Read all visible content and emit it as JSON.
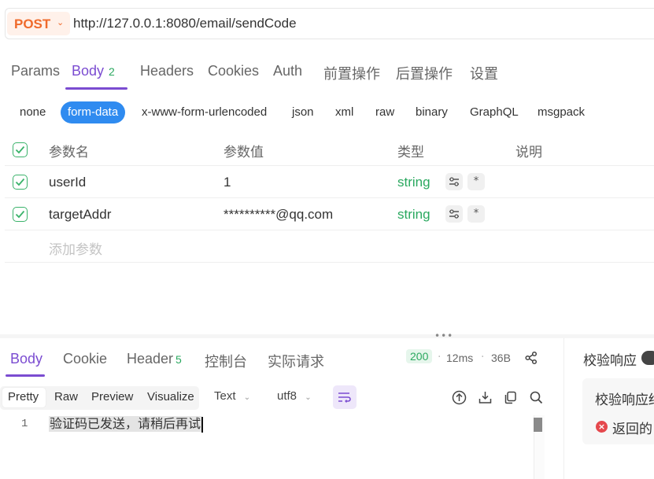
{
  "request": {
    "method": "POST",
    "url": "http://127.0.0.1:8080/email/sendCode"
  },
  "request_tabs": [
    {
      "label": "Params"
    },
    {
      "label": "Body",
      "badge": "2"
    },
    {
      "label": "Headers"
    },
    {
      "label": "Cookies"
    },
    {
      "label": "Auth"
    },
    {
      "label": "前置操作"
    },
    {
      "label": "后置操作"
    },
    {
      "label": "设置"
    }
  ],
  "body_types": [
    "none",
    "form-data",
    "x-www-form-urlencoded",
    "json",
    "xml",
    "raw",
    "binary",
    "GraphQL",
    "msgpack"
  ],
  "table": {
    "headers": {
      "name": "参数名",
      "value": "参数值",
      "type": "类型",
      "desc": "说明"
    },
    "rows": [
      {
        "name": "userId",
        "value": "1",
        "type": "string",
        "required": "*"
      },
      {
        "name": "targetAddr",
        "value": "**********@qq.com",
        "type": "string",
        "required": "*"
      }
    ],
    "add_placeholder": "添加参数"
  },
  "response_tabs": [
    {
      "label": "Body"
    },
    {
      "label": "Cookie"
    },
    {
      "label": "Header",
      "badge": "5"
    },
    {
      "label": "控制台"
    },
    {
      "label": "实际请求"
    }
  ],
  "response_meta": {
    "status": "200",
    "time": "12ms",
    "size": "36B"
  },
  "format_tabs": [
    "Pretty",
    "Raw",
    "Preview",
    "Visualize"
  ],
  "format_dropdowns": {
    "type": "Text",
    "encoding": "utf8"
  },
  "response_body": {
    "line_number": "1",
    "text": "验证码已发送，请稍后再试"
  },
  "right_panel": {
    "title": "校验响应",
    "subtitle": "校验响应结",
    "error_text": "返回的"
  },
  "colors": {
    "accent": "#7b4cd1",
    "method": "#ef6a2b",
    "pill_active": "#2f8bf0",
    "success": "#2aa85f",
    "error": "#e5484d"
  }
}
